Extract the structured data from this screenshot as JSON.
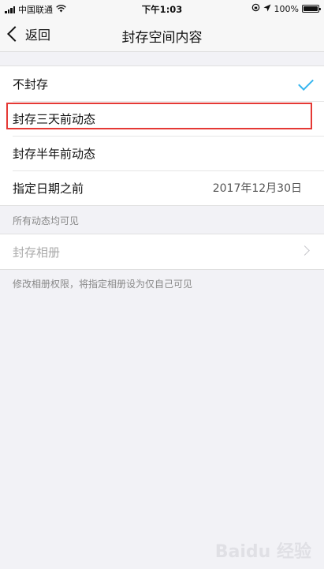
{
  "status_bar": {
    "carrier": "中国联通",
    "time": "下午1:03",
    "battery": "100%"
  },
  "nav": {
    "back_label": "返回",
    "title": "封存空间内容"
  },
  "options": [
    {
      "label": "不封存",
      "selected": true
    },
    {
      "label": "封存三天前动态",
      "selected": false
    },
    {
      "label": "封存半年前动态",
      "selected": false
    },
    {
      "label": "指定日期之前",
      "value": "2017年12月30日",
      "selected": false
    }
  ],
  "notes": {
    "visibility": "所有动态均可见",
    "album_hint": "修改相册权限，将指定相册设为仅自己可见"
  },
  "album": {
    "label": "封存相册"
  },
  "watermark": {
    "text": "Baidu 经验"
  },
  "colors": {
    "accent_check": "#35b5ef",
    "highlight_box": "#e53935"
  }
}
